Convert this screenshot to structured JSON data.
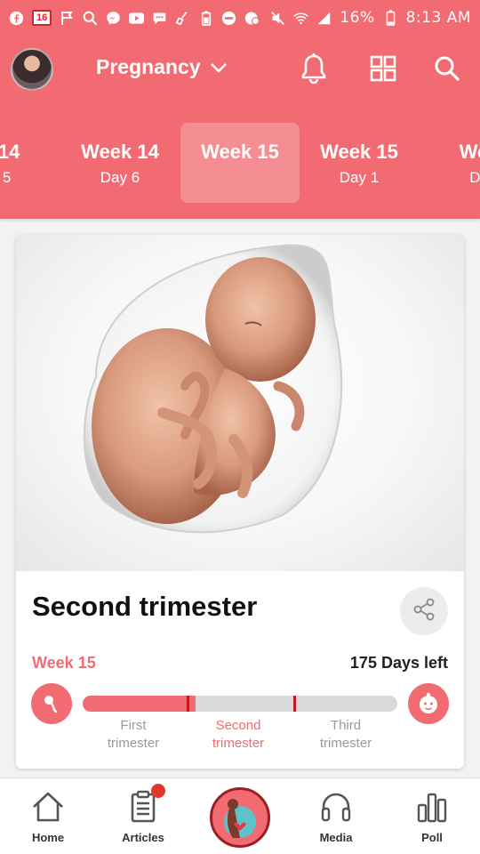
{
  "status_bar": {
    "notification_count": "16",
    "battery": "16%",
    "time": "8:13 AM"
  },
  "header": {
    "title": "Pregnancy",
    "icons": [
      "avatar",
      "chevron-down-icon",
      "bell-icon",
      "grid-icon",
      "search-icon"
    ]
  },
  "week_tabs": [
    {
      "week": "k 14",
      "day": "y 5"
    },
    {
      "week": "Week 14",
      "day": "Day 6"
    },
    {
      "week": "Week 15",
      "day": ""
    },
    {
      "week": "Week 15",
      "day": "Day 1"
    },
    {
      "week": "Wee",
      "day": "Da"
    }
  ],
  "card": {
    "title": "Second trimester",
    "week_label": "Week 15",
    "days_left": "175 Days left",
    "progress": {
      "value": 0.36,
      "markers": [
        0.33,
        0.67
      ]
    },
    "trimesters": [
      {
        "line1": "First",
        "line2": "trimester"
      },
      {
        "line1": "Second",
        "line2": "trimester"
      },
      {
        "line1": "Third",
        "line2": "trimester"
      }
    ]
  },
  "bottom_nav": {
    "items": [
      {
        "label": "Home"
      },
      {
        "label": "Articles"
      },
      {
        "label": ""
      },
      {
        "label": "Media"
      },
      {
        "label": "Poll"
      }
    ]
  },
  "colors": {
    "brand": "#f26b72",
    "brand_light": "#f58e93",
    "marker": "#c8171f",
    "track": "#d9d9d9"
  }
}
